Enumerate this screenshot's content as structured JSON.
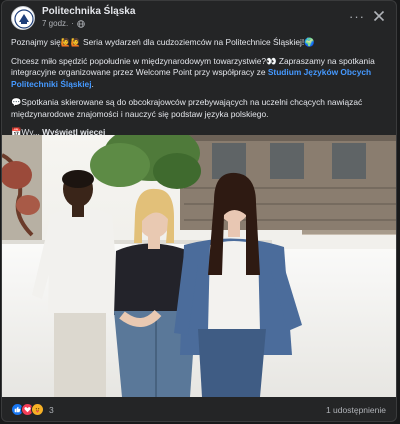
{
  "post": {
    "page_name": "Politechnika Śląska",
    "time": "7 godz.",
    "more_label": "···",
    "see_more": "Wyświetl więcej",
    "paragraph1": {
      "before": "Poznajmy się",
      "emoji": "🙋🙋",
      "after": " Seria wydarzeń dla cudzoziemców na Politechnice Śląskiej!🌍"
    },
    "paragraph2": {
      "before": "Chcesz miło spędzić popołudnie w międzynarodowym towarzystwie?👀 Zapraszamy na spotkania integracyjne organizowane przez Welcome Point przy współpracy ze ",
      "link": "Studium Języków Obcych Politechniki Śląskiej",
      "after": "."
    },
    "paragraph3": "💬Spotkania skierowane są do obcokrajowców przebywających na uczelni chcących nawiązać międzynarodowe znajomości i nauczyć się podstaw języka polskiego.",
    "paragraph4_prefix": "📅Wy..."
  },
  "footer": {
    "reaction_count": "3",
    "shares": "1 udostępnienie"
  },
  "colors": {
    "background": "#242526",
    "link": "#4599ff",
    "like": "#1877f2",
    "love": "#f33e58",
    "care": "#f7b125"
  },
  "icons": [
    "university-logo-icon",
    "globe-icon",
    "more-icon",
    "close-icon",
    "like-icon",
    "love-icon",
    "care-icon"
  ]
}
